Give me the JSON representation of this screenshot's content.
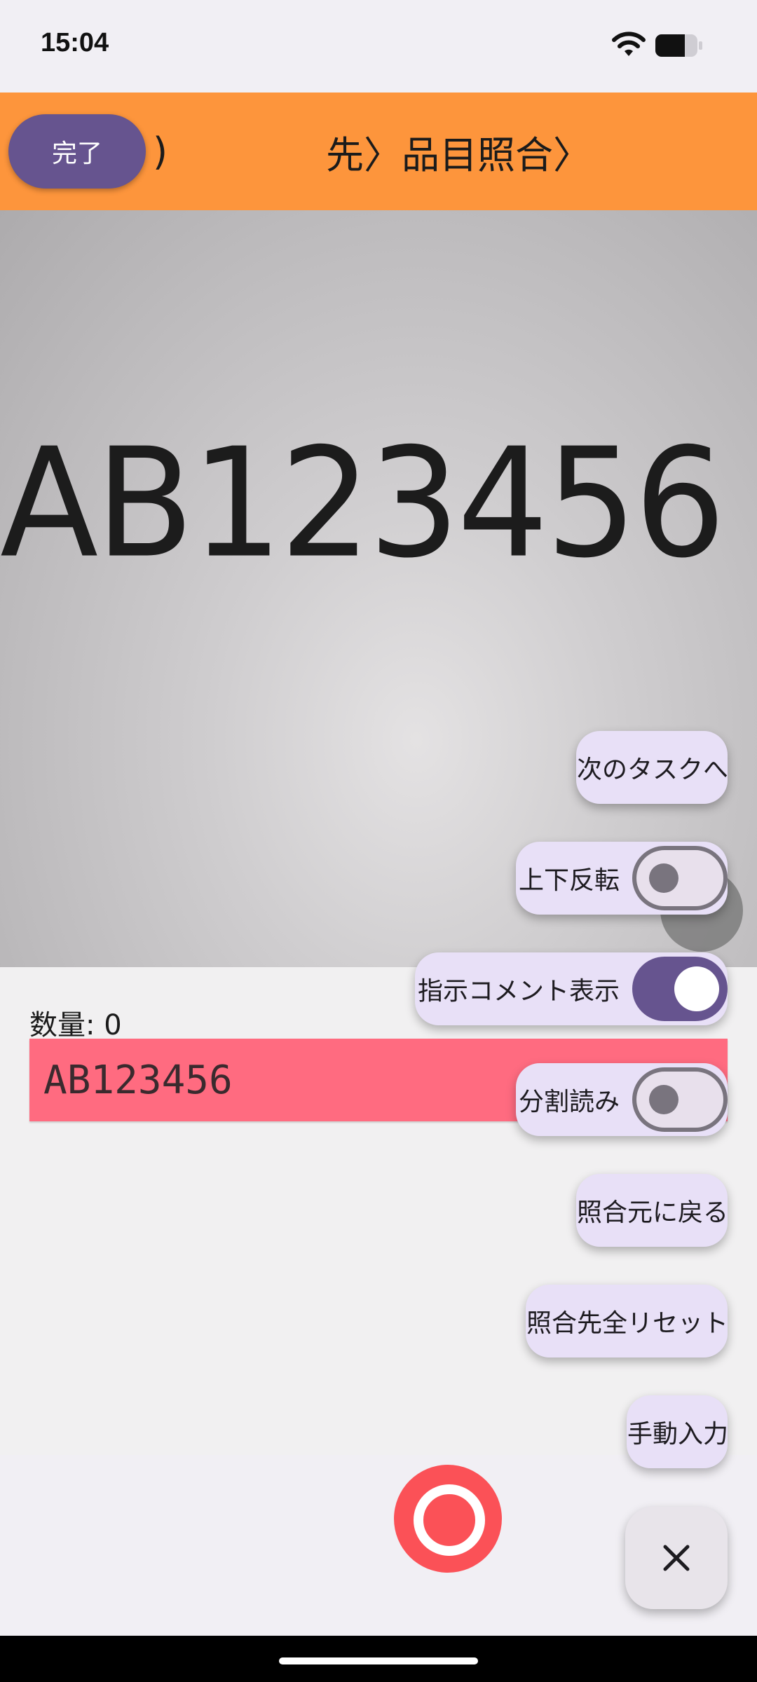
{
  "status": {
    "time": "15:04"
  },
  "header": {
    "title": "先〉品目照合〉",
    "fragment": ")",
    "done_label": "完了"
  },
  "camera": {
    "scanned_text": "AB123456"
  },
  "main": {
    "quantity_label": "数量: 0",
    "result_value": "AB123456"
  },
  "menu": {
    "next_task": "次のタスクへ",
    "flip": {
      "label": "上下反転",
      "on": false
    },
    "instruction_comment": {
      "label": "指示コメント表示",
      "on": true
    },
    "split_read": {
      "label": "分割読み",
      "on": false
    },
    "back_to_source": "照合元に戻る",
    "reset_all": "照合先全リセット",
    "manual_input": "手動入力"
  },
  "colors": {
    "header": "#fd953c",
    "accent": "#66548f",
    "result_bg": "#ff6b80",
    "shutter": "#fb5157",
    "fab_bg": "#e8e0f7"
  },
  "icons": [
    "wifi-icon",
    "battery-icon",
    "camera-settings-icon",
    "shutter-icon",
    "close-icon"
  ]
}
